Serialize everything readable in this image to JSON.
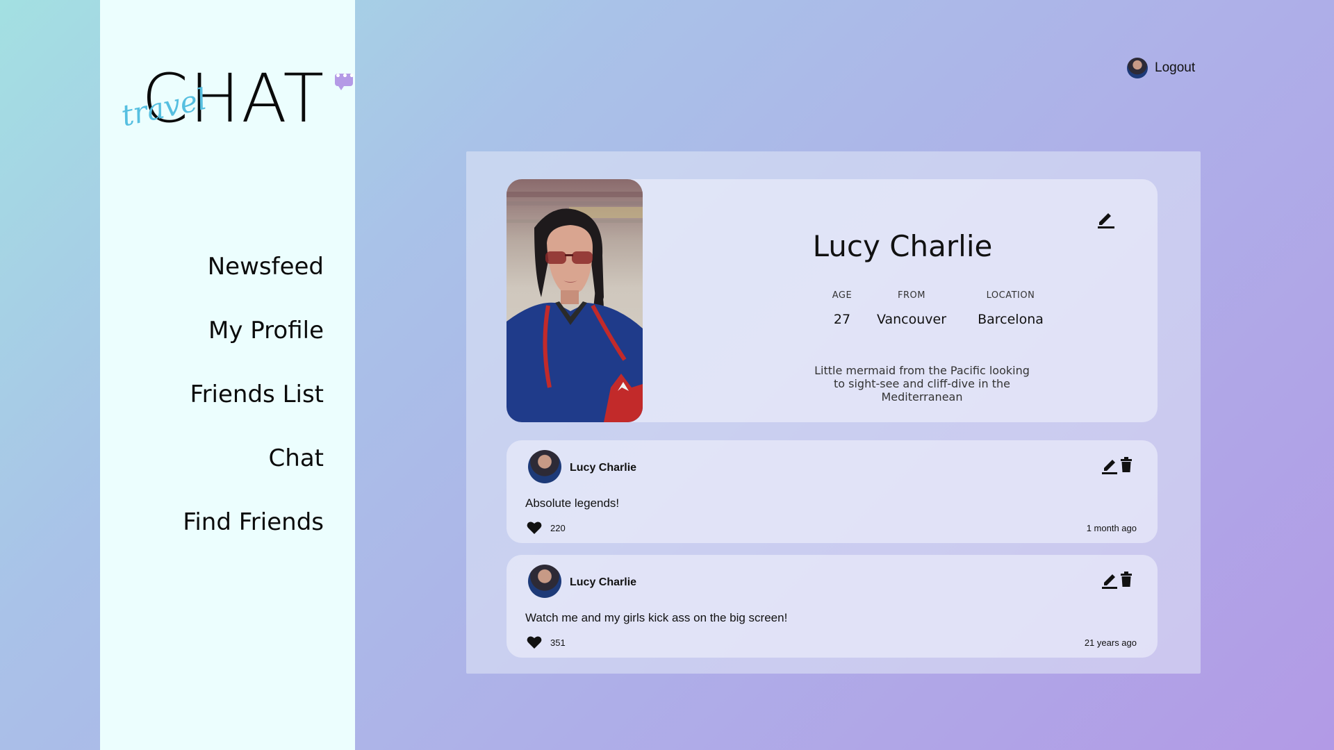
{
  "brand": {
    "script": "travel",
    "word": "CHAT",
    "bubble": "•••"
  },
  "nav": {
    "items": [
      {
        "label": "Newsfeed"
      },
      {
        "label": "My Profile"
      },
      {
        "label": "Friends List"
      },
      {
        "label": "Chat"
      },
      {
        "label": "Find Friends"
      }
    ]
  },
  "header": {
    "logout_label": "Logout",
    "avatar_icon": "user-avatar"
  },
  "profile": {
    "name": "Lucy Charlie",
    "edit_icon": "pencil-icon",
    "stats": {
      "age_label": "AGE",
      "age_value": "27",
      "from_label": "FROM",
      "from_value": "Vancouver",
      "location_label": "LOCATION",
      "location_value": "Barcelona"
    },
    "bio": "Little mermaid from the Pacific looking to sight-see and cliff-dive in the Mediterranean"
  },
  "posts": [
    {
      "author": "Lucy Charlie",
      "text": "Absolute legends!",
      "likes": "220",
      "time": "1 month ago"
    },
    {
      "author": "Lucy Charlie",
      "text": "Watch me and my girls kick ass on the big screen!",
      "likes": "351",
      "time": "21 years ago"
    }
  ],
  "colors": {
    "sidebar_bg": "#ecfefe",
    "accent_purple": "#b49ae6",
    "logo_script": "#56bfe0",
    "bg_gradient_start": "#a3e0e2",
    "bg_gradient_end": "#b29ae6"
  }
}
